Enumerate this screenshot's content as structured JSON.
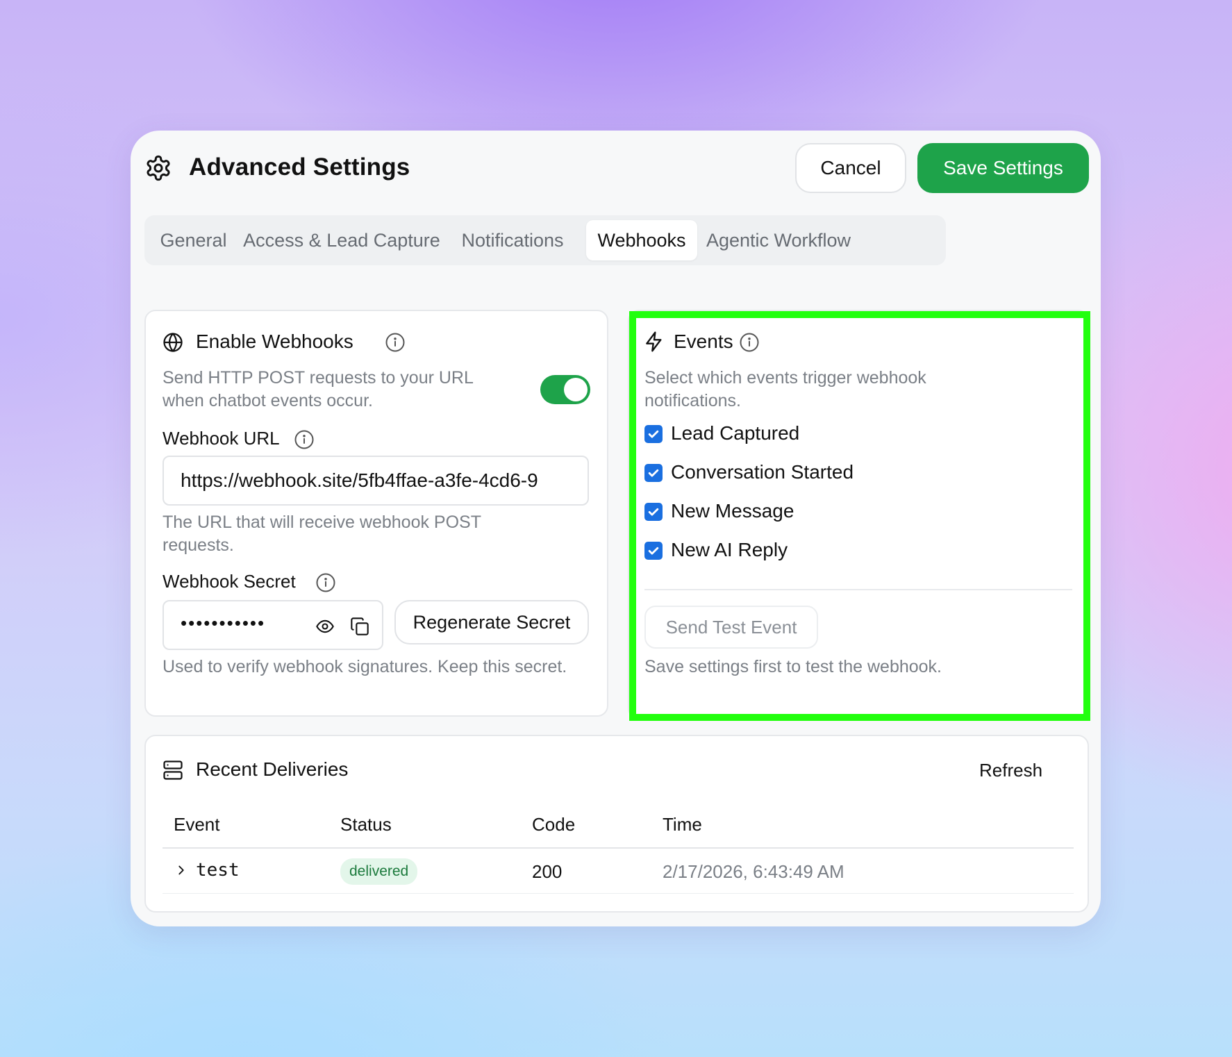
{
  "header": {
    "title": "Advanced Settings",
    "cancel_label": "Cancel",
    "save_label": "Save Settings"
  },
  "tabs": [
    {
      "label": "General",
      "active": false
    },
    {
      "label": "Access & Lead Capture",
      "active": false
    },
    {
      "label": "Notifications",
      "active": false
    },
    {
      "label": "Webhooks",
      "active": true
    },
    {
      "label": "Agentic Workflow",
      "active": false
    }
  ],
  "enable_panel": {
    "title": "Enable Webhooks",
    "description": "Send HTTP POST requests to your URL when chatbot events occur.",
    "enabled": true,
    "url_label": "Webhook URL",
    "url_value": "https://webhook.site/5fb4ffae-a3fe-4cd6-9",
    "url_help": "The URL that will receive webhook POST requests.",
    "secret_label": "Webhook Secret",
    "secret_value": "•••••••••••",
    "regenerate_label": "Regenerate Secret",
    "secret_help": "Used to verify webhook signatures. Keep this secret."
  },
  "events_panel": {
    "title": "Events",
    "description": "Select which events trigger webhook notifications.",
    "events": [
      {
        "label": "Lead Captured",
        "checked": true
      },
      {
        "label": "Conversation Started",
        "checked": true
      },
      {
        "label": "New Message",
        "checked": true
      },
      {
        "label": "New AI Reply",
        "checked": true
      }
    ],
    "test_label": "Send Test Event",
    "test_help": "Save settings first to test the webhook."
  },
  "deliveries": {
    "title": "Recent Deliveries",
    "refresh_label": "Refresh",
    "columns": [
      "Event",
      "Status",
      "Code",
      "Time"
    ],
    "rows": [
      {
        "event": "test",
        "status": "delivered",
        "code": "200",
        "time": "2/17/2026, 6:43:49 AM"
      }
    ]
  },
  "colors": {
    "accent_green": "#1ea34a",
    "checkbox_blue": "#1a6fe0",
    "highlight": "#22ff0e"
  }
}
